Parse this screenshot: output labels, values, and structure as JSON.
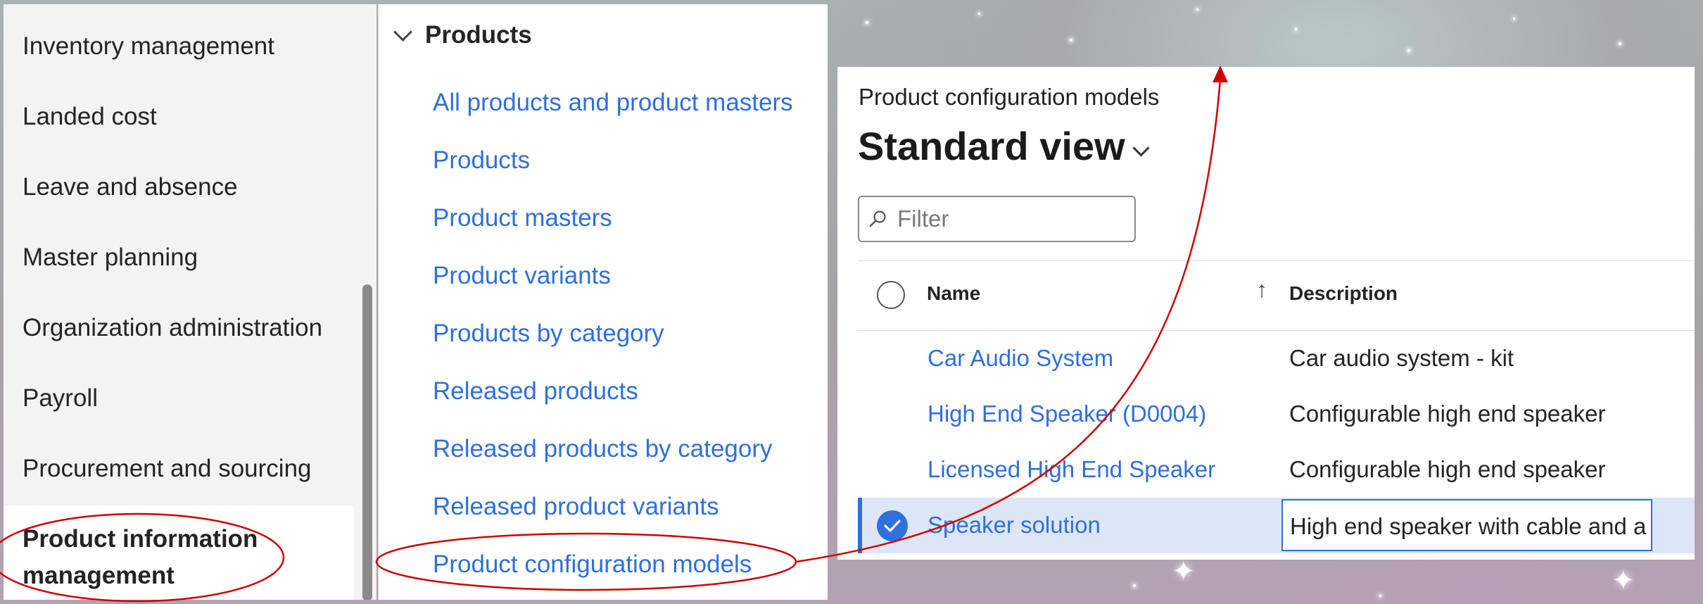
{
  "nav": {
    "items": [
      {
        "label": "Inventory management"
      },
      {
        "label": "Landed cost"
      },
      {
        "label": "Leave and absence"
      },
      {
        "label": "Master planning"
      },
      {
        "label": "Organization administration"
      },
      {
        "label": "Payroll"
      },
      {
        "label": "Procurement and sourcing"
      }
    ],
    "selected_label": "Product information management"
  },
  "menu": {
    "group_label": "Products",
    "links": [
      {
        "label": "All products and product masters"
      },
      {
        "label": "Products"
      },
      {
        "label": "Product masters"
      },
      {
        "label": "Product variants"
      },
      {
        "label": "Products by category"
      },
      {
        "label": "Released products"
      },
      {
        "label": "Released products by category"
      },
      {
        "label": "Released product variants"
      },
      {
        "label": "Product configuration models"
      }
    ]
  },
  "page": {
    "caption": "Product configuration models",
    "view_title": "Standard view",
    "filter_placeholder": "Filter",
    "filter_value": ""
  },
  "grid": {
    "columns": {
      "name": "Name",
      "description": "Description"
    },
    "rows": [
      {
        "name": "Car Audio System",
        "description": "Car audio system - kit"
      },
      {
        "name": "High End Speaker (D0004)",
        "description": "Configurable high end speaker"
      },
      {
        "name": "Licensed High End Speaker",
        "description": "Configurable high end speaker"
      },
      {
        "name": "Speaker solution",
        "description": "High end speaker with cable and a"
      }
    ],
    "selected_row": 4
  },
  "colors": {
    "link": "#2f6fde",
    "selected_row": "#dde6f7",
    "annotation": "#d00000"
  },
  "icons": [
    "chevron-down-icon",
    "search-icon",
    "sort-ascending-icon",
    "checkmark-icon"
  ]
}
